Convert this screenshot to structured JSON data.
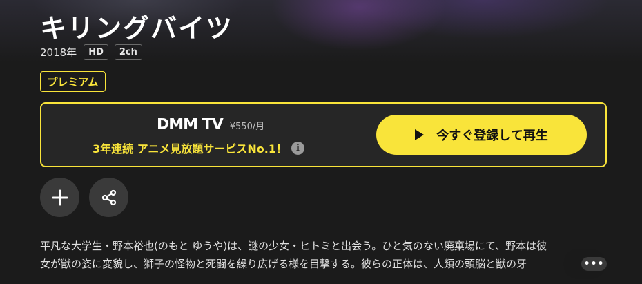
{
  "title": "キリングバイツ",
  "meta": {
    "year": "2018年",
    "tags": [
      "HD",
      "2ch"
    ]
  },
  "premium_label": "プレミアム",
  "promo": {
    "brand": "DMM TV",
    "price": "¥550/月",
    "tagline": "3年連続 アニメ見放題サービスNo.1！",
    "info_icon": "info-icon",
    "play_icon": "play-icon",
    "play_label": "今すぐ登録して再生"
  },
  "actions": {
    "add_icon": "plus-icon",
    "share_icon": "share-icon"
  },
  "description": {
    "line1": "平凡な大学生・野本裕也(のもと ゆうや)は、謎の少女・ヒトミと出会う。ひと気のない廃棄場にて、野本は彼",
    "line2": "女が獣の姿に変貌し、獅子の怪物と死闘を繰り広げる様を目撃する。彼らの正体は、人類の頭脳と獣の牙",
    "more_label": "•••"
  },
  "colors": {
    "accent": "#f9e43a",
    "background": "#1b1b1b",
    "card": "#262626",
    "button": "#3a3a3a"
  }
}
